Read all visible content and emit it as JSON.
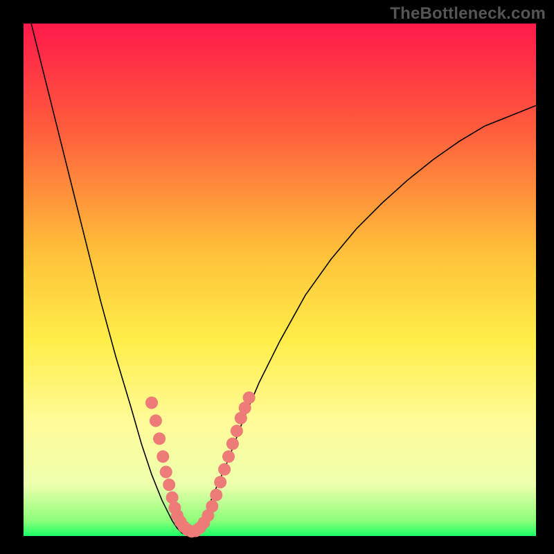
{
  "watermark": "TheBottleneck.com",
  "chart_data": {
    "type": "line",
    "title": "",
    "xlabel": "",
    "ylabel": "",
    "xlim": [
      0,
      100
    ],
    "ylim": [
      0,
      100
    ],
    "gradient_stops": [
      {
        "pct": 0,
        "color": "#ff1a4b"
      },
      {
        "pct": 20,
        "color": "#ff5a3c"
      },
      {
        "pct": 45,
        "color": "#ffc23a"
      },
      {
        "pct": 62,
        "color": "#ffee4a"
      },
      {
        "pct": 78,
        "color": "#fffb9a"
      },
      {
        "pct": 90,
        "color": "#edffad"
      },
      {
        "pct": 97,
        "color": "#8dff7a"
      },
      {
        "pct": 100,
        "color": "#1aff66"
      }
    ],
    "series": [
      {
        "name": "bottleneck-curve",
        "color": "#000000",
        "width": 1.6,
        "x": [
          0,
          3,
          6,
          9,
          12,
          15,
          18,
          21,
          23,
          25,
          27,
          29,
          30,
          31,
          32,
          33,
          34,
          35,
          37,
          40,
          43,
          46,
          50,
          55,
          60,
          65,
          70,
          75,
          80,
          85,
          90,
          95,
          100
        ],
        "values": [
          106,
          94,
          82,
          70,
          58,
          46,
          35,
          25,
          18,
          12,
          7,
          3,
          1.5,
          0.5,
          0.2,
          0.3,
          1,
          3,
          8,
          15,
          23,
          30,
          38,
          47,
          54,
          60,
          65,
          69.5,
          73.5,
          77,
          80,
          82,
          84
        ]
      }
    ],
    "marker_cluster": {
      "color": "#ed7b77",
      "radius_large": 9,
      "radius_small": 9,
      "points": [
        {
          "x": 25.0,
          "y": 26.0
        },
        {
          "x": 25.8,
          "y": 22.5
        },
        {
          "x": 26.5,
          "y": 19.0
        },
        {
          "x": 27.2,
          "y": 15.5
        },
        {
          "x": 27.8,
          "y": 12.5
        },
        {
          "x": 28.4,
          "y": 10.0
        },
        {
          "x": 29.0,
          "y": 7.5
        },
        {
          "x": 29.5,
          "y": 5.5
        },
        {
          "x": 30.0,
          "y": 4.0
        },
        {
          "x": 30.6,
          "y": 2.8
        },
        {
          "x": 31.3,
          "y": 1.8
        },
        {
          "x": 32.0,
          "y": 1.2
        },
        {
          "x": 32.8,
          "y": 0.9
        },
        {
          "x": 33.6,
          "y": 1.0
        },
        {
          "x": 34.4,
          "y": 1.6
        },
        {
          "x": 35.2,
          "y": 2.6
        },
        {
          "x": 36.0,
          "y": 4.0
        },
        {
          "x": 36.8,
          "y": 5.8
        },
        {
          "x": 37.6,
          "y": 8.0
        },
        {
          "x": 38.4,
          "y": 10.5
        },
        {
          "x": 39.2,
          "y": 13.0
        },
        {
          "x": 40.0,
          "y": 15.5
        },
        {
          "x": 40.8,
          "y": 18.0
        },
        {
          "x": 41.6,
          "y": 20.5
        },
        {
          "x": 42.4,
          "y": 23.0
        },
        {
          "x": 43.2,
          "y": 25.0
        },
        {
          "x": 44.0,
          "y": 27.0
        }
      ]
    }
  }
}
